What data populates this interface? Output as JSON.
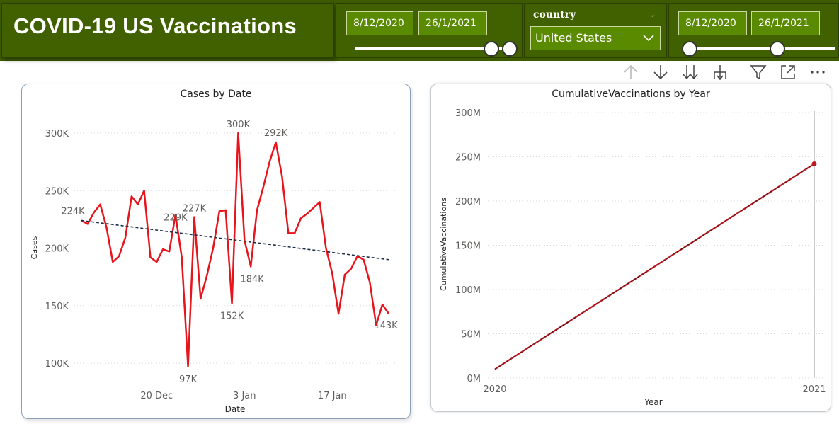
{
  "header": {
    "title": "COVID-19 US Vaccinations",
    "date_slicer_1": {
      "start": "8/12/2020",
      "end": "26/1/2021",
      "range_fraction": [
        0.93,
        1.0
      ]
    },
    "country_slicer": {
      "label": "country",
      "value": "United States"
    },
    "date_slicer_2": {
      "start": "8/12/2020",
      "end": "26/1/2021",
      "range_fraction": [
        0.0,
        0.6
      ]
    }
  },
  "visual_header": {
    "icons": [
      "arrow-up-icon",
      "arrow-down-icon",
      "double-arrow-down-icon",
      "expand-hierarchy-icon",
      "filter-icon",
      "focus-mode-icon",
      "more-options-icon"
    ]
  },
  "cases_chart": {
    "title": "Cases by Date",
    "xlabel": "Date",
    "ylabel": "Cases",
    "y_ticks": [
      "300K",
      "250K",
      "200K",
      "150K",
      "100K"
    ],
    "x_ticks": [
      "20 Dec",
      "3 Jan",
      "17 Jan"
    ]
  },
  "vacc_chart": {
    "title": "CumulativeVaccinations by Year",
    "xlabel": "Year",
    "ylabel": "CumulativeVaccinations",
    "y_ticks": [
      "300M",
      "250M",
      "200M",
      "150M",
      "100M",
      "50M",
      "0M"
    ],
    "x_ticks": [
      "2020",
      "2021"
    ]
  },
  "colors": {
    "header_bg": "#3d5c00",
    "slicer_bg": "#5a8a00",
    "cases_line": "#e8141c",
    "trend_line": "#1c2f4a",
    "vacc_line": "#c0161e"
  },
  "chart_data": [
    {
      "type": "line",
      "title": "Cases by Date",
      "xlabel": "Date",
      "ylabel": "Cases",
      "x_start": "2020-12-08",
      "x_end": "2021-01-26",
      "ylim": [
        85000,
        320000
      ],
      "series": [
        {
          "values": [
            224000,
            221000,
            231000,
            238000,
            218000,
            188000,
            193000,
            209000,
            245000,
            238000,
            250000,
            192000,
            188000,
            199000,
            197000,
            229000,
            192000,
            97000,
            227000,
            156000,
            176000,
            200000,
            232000,
            233000,
            152000,
            300000,
            207000,
            184000,
            233000,
            253000,
            275000,
            292000,
            262000,
            213000,
            213000,
            226000,
            230000,
            235000,
            240000,
            200000,
            178000,
            143000,
            177000,
            182000,
            193000,
            190000,
            170000,
            133000,
            151000,
            143000
          ]
        },
        {
          "values": [
            224000,
            190000
          ]
        }
      ],
      "data_labels": [
        {
          "index": 0,
          "text": "224K"
        },
        {
          "index": 15,
          "text": "229K"
        },
        {
          "index": 17,
          "text": "97K"
        },
        {
          "index": 18,
          "text": "227K"
        },
        {
          "index": 24,
          "text": "152K"
        },
        {
          "index": 25,
          "text": "300K"
        },
        {
          "index": 27,
          "text": "184K"
        },
        {
          "index": 31,
          "text": "292K"
        },
        {
          "index": 49,
          "text": "143K"
        }
      ]
    },
    {
      "type": "line",
      "title": "CumulativeVaccinations by Year",
      "xlabel": "Year",
      "ylabel": "CumulativeVaccinations",
      "categories": [
        "2020",
        "2021"
      ],
      "values": [
        10000000,
        242000000
      ],
      "ylim": [
        0,
        300000000
      ]
    }
  ]
}
